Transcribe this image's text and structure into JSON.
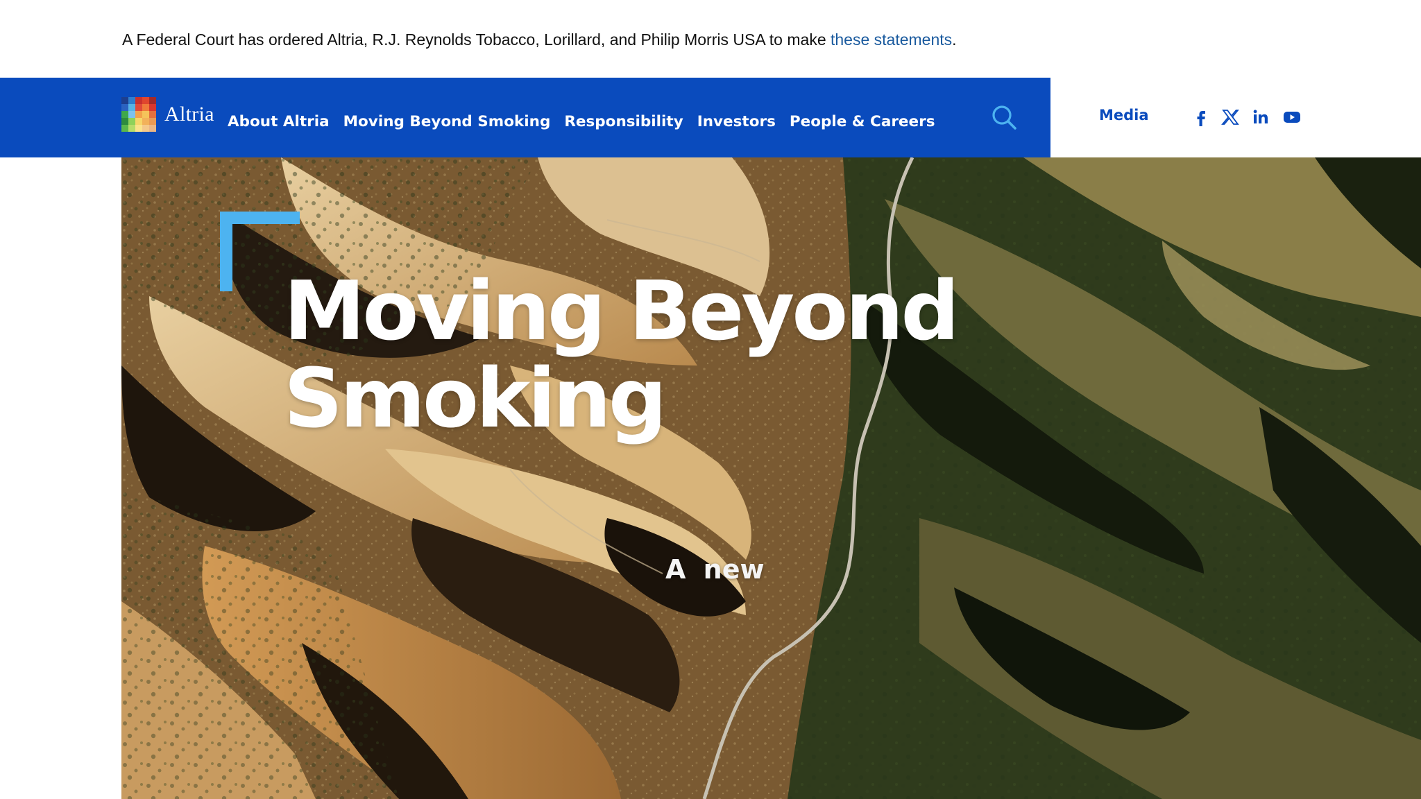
{
  "notice": {
    "text": "A Federal Court has ordered Altria, R.J. Reynolds Tobacco, Lorillard, and Philip Morris USA to make ",
    "link_text": "these statements",
    "suffix": "."
  },
  "header": {
    "brand": "Altria",
    "nav": [
      {
        "label": "About Altria"
      },
      {
        "label": "Moving Beyond Smoking"
      },
      {
        "label": "Responsibility"
      },
      {
        "label": "Investors"
      },
      {
        "label": "People & Careers"
      }
    ],
    "search_icon": "search-icon",
    "media_label": "Media",
    "social_icons": [
      "facebook-icon",
      "x-icon",
      "linkedin-icon",
      "youtube-icon"
    ]
  },
  "hero": {
    "title_line1": "Moving Beyond",
    "title_line2": "Smoking",
    "caption": "A new"
  },
  "colors": {
    "nav_bg": "#0a4bbd",
    "accent_light_blue": "#4db3f0",
    "link": "#1a5a9e",
    "white": "#ffffff"
  }
}
